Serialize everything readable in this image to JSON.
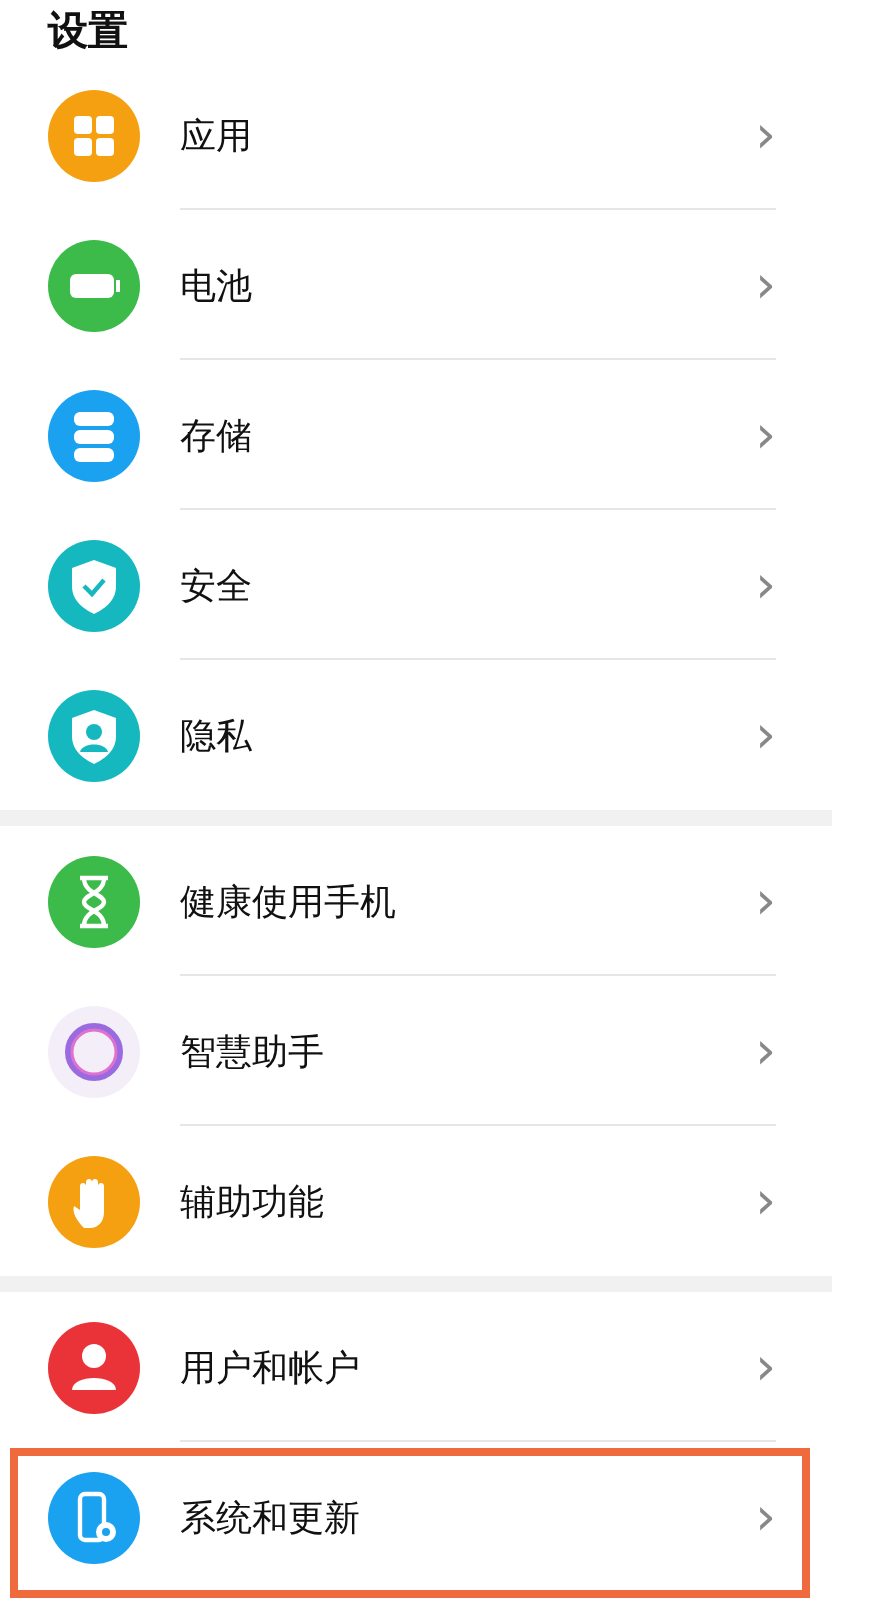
{
  "title": "设置",
  "groups": [
    {
      "items": [
        {
          "kind": "apps",
          "label": "应用",
          "chevron": "›",
          "highlighted": false
        },
        {
          "kind": "battery",
          "label": "电池",
          "chevron": "›",
          "highlighted": false
        },
        {
          "kind": "storage",
          "label": "存储",
          "chevron": "›",
          "highlighted": false
        },
        {
          "kind": "security",
          "label": "安全",
          "chevron": "›",
          "highlighted": false
        },
        {
          "kind": "privacy",
          "label": "隐私",
          "chevron": "›",
          "highlighted": false
        }
      ]
    },
    {
      "items": [
        {
          "kind": "hourglass",
          "label": "健康使用手机",
          "chevron": "›",
          "highlighted": false
        },
        {
          "kind": "assistant",
          "label": "智慧助手",
          "chevron": "›",
          "highlighted": false
        },
        {
          "kind": "hand",
          "label": "辅助功能",
          "chevron": "›",
          "highlighted": false
        }
      ]
    },
    {
      "items": [
        {
          "kind": "user",
          "label": "用户和帐户",
          "chevron": "›",
          "highlighted": false
        },
        {
          "kind": "system",
          "label": "系统和更新",
          "chevron": "›",
          "highlighted": true
        }
      ]
    }
  ]
}
